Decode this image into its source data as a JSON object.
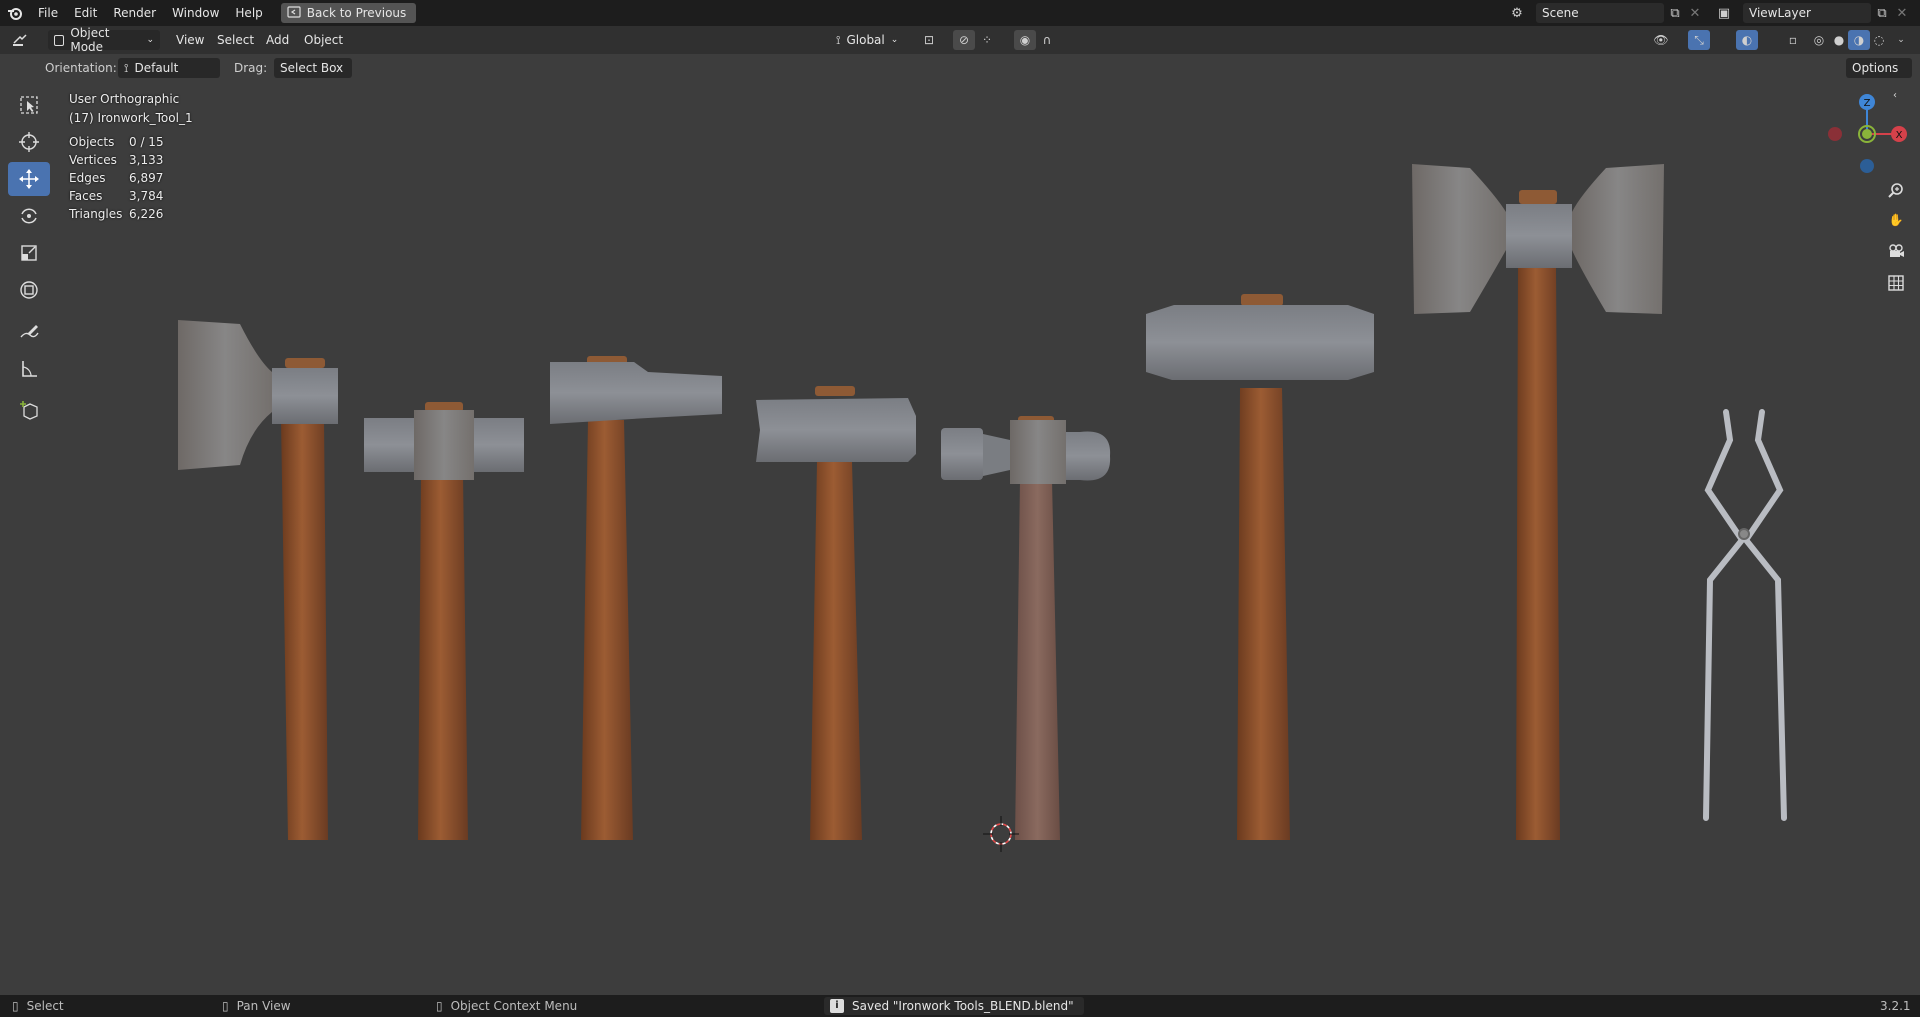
{
  "menu": {
    "items": [
      "File",
      "Edit",
      "Render",
      "Window",
      "Help"
    ],
    "back_button": "Back to Previous"
  },
  "scene": {
    "name": "Scene",
    "view_layer": "ViewLayer"
  },
  "header": {
    "mode": "Object Mode",
    "view": "View",
    "select": "Select",
    "add": "Add",
    "object": "Object",
    "transform_orientation": "Global",
    "options": "Options"
  },
  "tool_settings": {
    "orientation_label": "Orientation:",
    "orientation_value": "Default",
    "drag_label": "Drag:",
    "drag_value": "Select Box"
  },
  "viewport": {
    "view_name": "User Orthographic",
    "active_object": "(17) Ironwork_Tool_1",
    "stats": [
      {
        "label": "Objects",
        "value": "0 / 15"
      },
      {
        "label": "Vertices",
        "value": "3,133"
      },
      {
        "label": "Edges",
        "value": "6,897"
      },
      {
        "label": "Faces",
        "value": "3,784"
      },
      {
        "label": "Triangles",
        "value": "6,226"
      }
    ]
  },
  "gizmo": {
    "z": "Z",
    "x": "X"
  },
  "statusbar": {
    "select": "Select",
    "pan_view": "Pan View",
    "context_menu": "Object Context Menu",
    "saved_message": "Saved \"Ironwork Tools_BLEND.blend\"",
    "version": "3.2.1"
  },
  "colors": {
    "accent": "#4a73b0",
    "axis_x": "#d5414a",
    "axis_y": "#8ab43a",
    "axis_z": "#3f86d7"
  }
}
